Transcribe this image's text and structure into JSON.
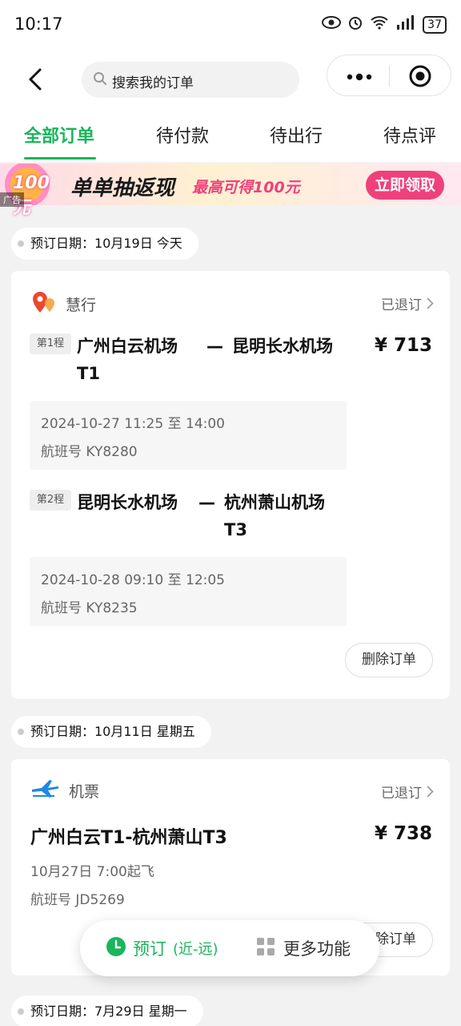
{
  "status_bar": {
    "time": "10:17",
    "battery": "37"
  },
  "header": {
    "search_placeholder": "搜索我的订单",
    "tabs": [
      {
        "label": "全部订单",
        "active": true
      },
      {
        "label": "待付款"
      },
      {
        "label": "待出行"
      },
      {
        "label": "待点评"
      }
    ]
  },
  "banner": {
    "badge_text": "100元",
    "ad_tag": "广告",
    "title": "单单抽返现",
    "subtitle": "最高可得100元",
    "button": "立即领取"
  },
  "orders": [
    {
      "date_label": "预订日期：10月19日 今天",
      "brand": "慧行",
      "status": "已退订",
      "price": "¥ 713",
      "legs": [
        {
          "tag": "第1程",
          "from": "广州白云机场",
          "from_terminal": "T1",
          "dash": "—",
          "to": "昆明长水机场",
          "time": "2024-10-27 11:25 至 14:00",
          "flight": "航班号 KY8280"
        },
        {
          "tag": "第2程",
          "from": "昆明长水机场",
          "dash": "—",
          "to": "杭州萧山机场",
          "to_terminal": "T3",
          "time": "2024-10-28 09:10 至 12:05",
          "flight": "航班号 KY8235"
        }
      ],
      "action": "删除订单"
    },
    {
      "date_label": "预订日期：10月11日 星期五",
      "brand": "机票",
      "status": "已退订",
      "price": "¥ 738",
      "route": "广州白云T1-杭州萧山T3",
      "depart": "10月27日 7:00起飞",
      "flight": "航班号 JD5269",
      "action": "删除订单"
    },
    {
      "date_label": "预订日期：7月29日 星期一"
    }
  ],
  "float_bar": {
    "book_label": "预订",
    "book_sub": "(近-远)",
    "more_label": "更多功能"
  },
  "colors": {
    "accent": "#1bb55c",
    "promo": "#f0407c"
  }
}
